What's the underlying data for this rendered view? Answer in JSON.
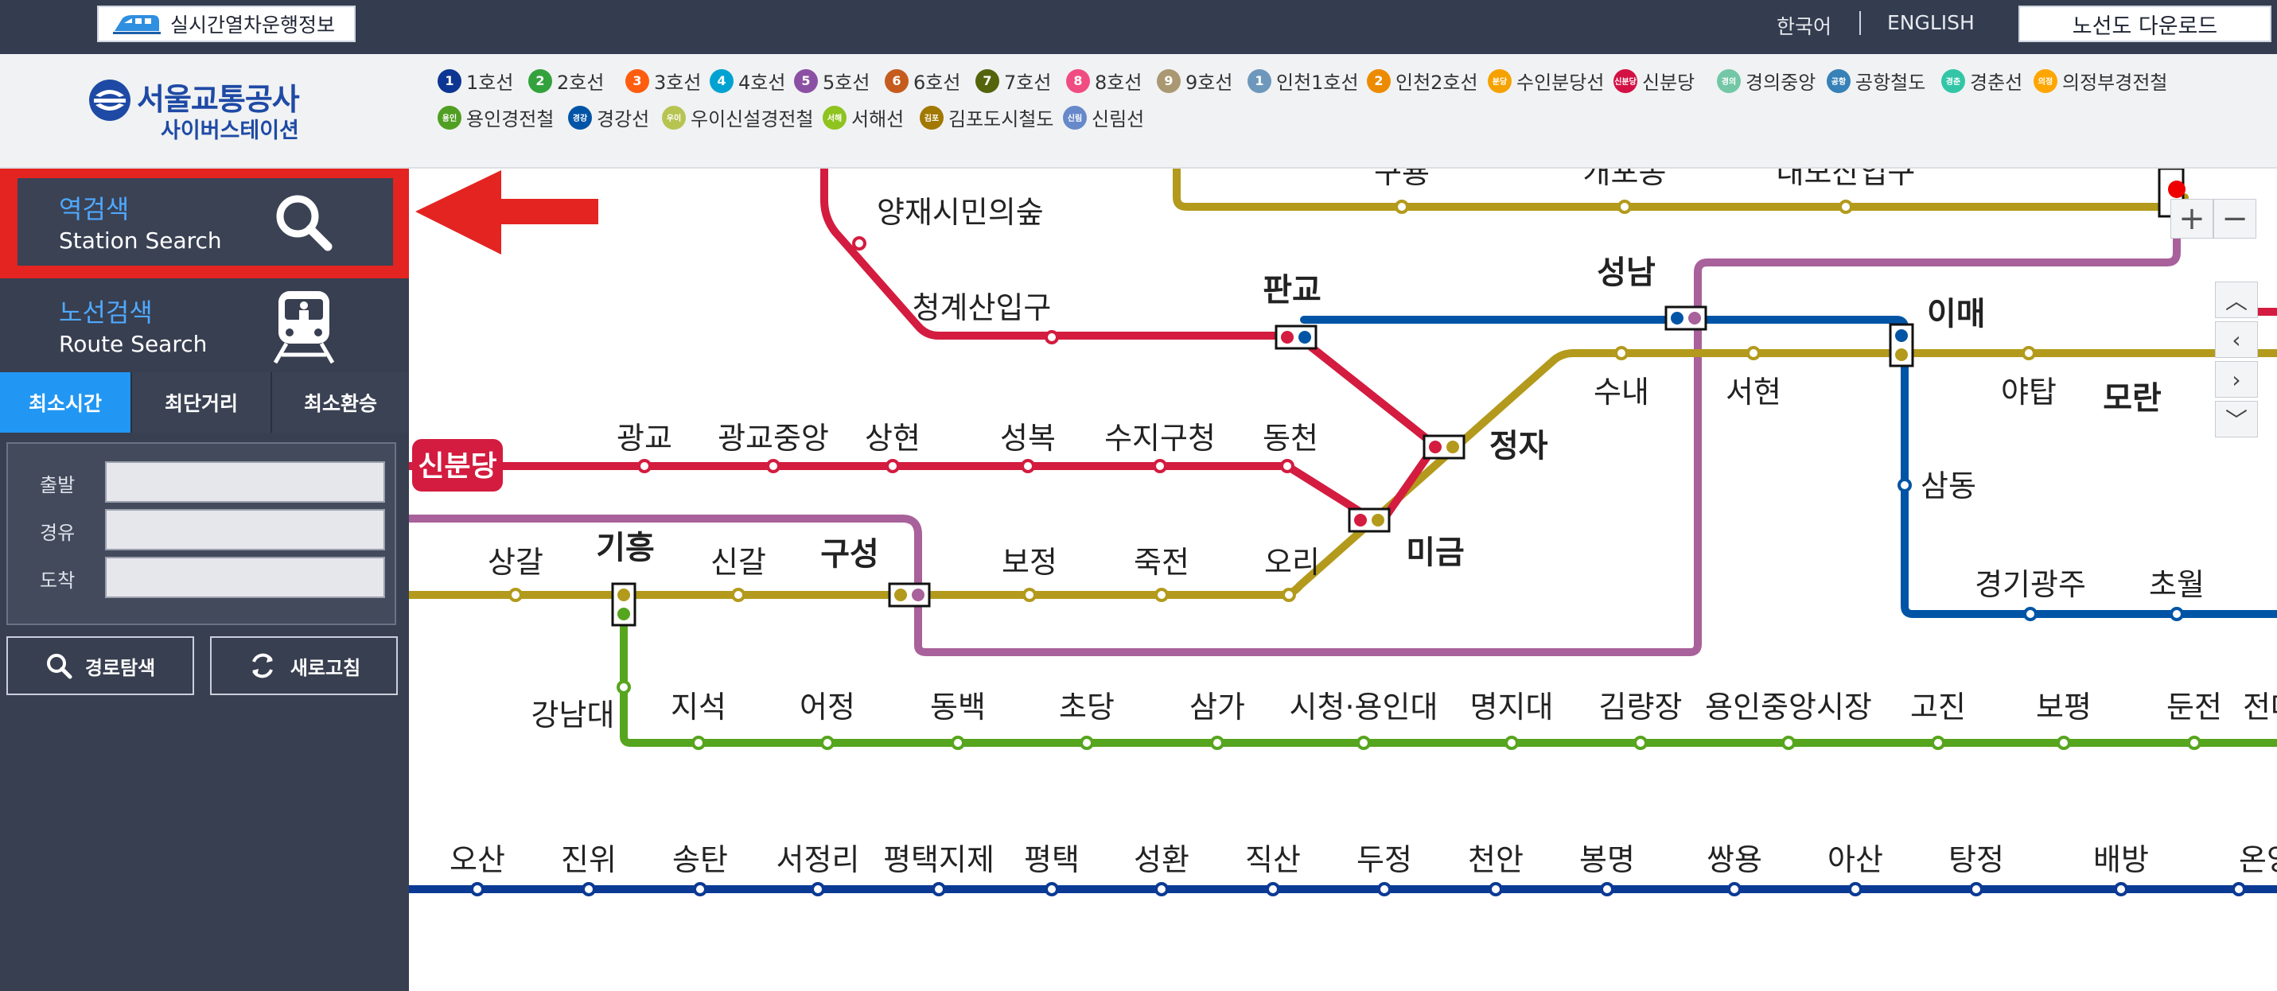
{
  "topbar": {
    "realtime_label": "실시간열차운행정보",
    "lang_korean": "한국어",
    "lang_english": "ENGLISH",
    "download_label": "노선도 다운로드"
  },
  "logo": {
    "line1": "서울교통공사",
    "line2": "사이버스테이션"
  },
  "legend": [
    {
      "badge": "1",
      "label": "1호선",
      "color": "#0d3692"
    },
    {
      "badge": "2",
      "label": "2호선",
      "color": "#33a23d"
    },
    {
      "badge": "3",
      "label": "3호선",
      "color": "#fe5d10"
    },
    {
      "badge": "4",
      "label": "4호선",
      "color": "#00a2d1"
    },
    {
      "badge": "5",
      "label": "5호선",
      "color": "#8b50a4"
    },
    {
      "badge": "6",
      "label": "6호선",
      "color": "#c55c1d"
    },
    {
      "badge": "7",
      "label": "7호선",
      "color": "#54640d"
    },
    {
      "badge": "8",
      "label": "8호선",
      "color": "#f14c82"
    },
    {
      "badge": "9",
      "label": "9호선",
      "color": "#aa9872"
    },
    {
      "badge": "1",
      "label": "인천1호선",
      "color": "#6e98bb"
    },
    {
      "badge": "2",
      "label": "인천2호선",
      "color": "#ed8b00"
    },
    {
      "badge": "분당",
      "label": "수인분당선",
      "color": "#f5a200"
    },
    {
      "badge": "신분당",
      "label": "신분당",
      "color": "#d31145"
    },
    {
      "badge": "경의",
      "label": "경의중앙",
      "color": "#73c7a6"
    },
    {
      "badge": "공항",
      "label": "공항철도",
      "color": "#3681b7"
    },
    {
      "badge": "경춘",
      "label": "경춘선",
      "color": "#32c6a6"
    },
    {
      "badge": "의정",
      "label": "의정부경전철",
      "color": "#fda600"
    },
    {
      "badge": "용인",
      "label": "용인경전철",
      "color": "#509f22"
    },
    {
      "badge": "경강",
      "label": "경강선",
      "color": "#0054a6"
    },
    {
      "badge": "우이",
      "label": "우이신설경전철",
      "color": "#b7c452"
    },
    {
      "badge": "서해",
      "label": "서해선",
      "color": "#8fc31f"
    },
    {
      "badge": "김포",
      "label": "김포도시철도",
      "color": "#a17800"
    },
    {
      "badge": "신림",
      "label": "신림선",
      "color": "#6789ca"
    }
  ],
  "sidebar": {
    "station_search": {
      "title": "역검색",
      "sub": "Station Search"
    },
    "route_search": {
      "title": "노선검색",
      "sub": "Route Search"
    },
    "tabs": [
      "최소시간",
      "최단거리",
      "최소환승"
    ],
    "form": {
      "departure": "출발",
      "via": "경유",
      "arrival": "도착"
    },
    "search_button": "경로탐색",
    "refresh_button": "새로고침"
  },
  "map": {
    "badge_sinbundang": "신분당",
    "stations": {
      "yangjae": "양재시민의숲",
      "cheonggye": "청계산입구",
      "pangyo": "판교",
      "seongnam": "성남",
      "imae": "이매",
      "gwanggyo": "광교",
      "gwanggyo_jungang": "광교중앙",
      "sanghyeon": "상현",
      "seongbok": "성복",
      "suji": "수지구청",
      "dongcheon": "동천",
      "jeongja": "정자",
      "sunae": "수내",
      "seohyeon": "서현",
      "yatap": "야탑",
      "moran": "모란",
      "samdong": "삼동",
      "sangal": "상갈",
      "giheung": "기흥",
      "singal": "신갈",
      "guseong": "구성",
      "bojeong": "보정",
      "jukjeon": "죽전",
      "ori": "오리",
      "migeum": "미금",
      "gyeonggi_gwangju": "경기광주",
      "chowol": "초월",
      "gangnamdae": "강남대",
      "jiseok": "지석",
      "eojeong": "어정",
      "dongbaek": "동백",
      "chodang": "초당",
      "samga": "삼가",
      "sicheong": "시청·용인대",
      "myongji": "명지대",
      "gimnyangjang": "김량장",
      "yongin_market": "용인중앙시장",
      "gojin": "고진",
      "bopyeong": "보평",
      "dunjeon": "둔전",
      "jeondae": "전대",
      "osan": "오산",
      "jinwi": "진위",
      "songtan": "송탄",
      "seojeongni": "서정리",
      "pyeongtaek_jije": "평택지제",
      "pyeongtaek": "평택",
      "seonghwan": "성환",
      "jiksan": "직산",
      "dujeong": "두정",
      "cheonan": "천안",
      "bongmyeong": "봉명",
      "ssangyong": "쌍용",
      "asan": "아산",
      "tangjeong": "탕정",
      "baebang": "배방",
      "onyang": "온양온천",
      "top1": "구룡",
      "top2": "개포동",
      "top3": "대모산입구"
    }
  },
  "colors": {
    "sinbundang": "#d31c3f",
    "suin_bundang": "#b39a1c",
    "gyeonggang": "#0054a6",
    "line8": "#a8619a",
    "everline": "#56a51e",
    "line1": "#0b3a94",
    "accent_blue": "#4fa8ff",
    "highlight_red": "#e32421"
  }
}
